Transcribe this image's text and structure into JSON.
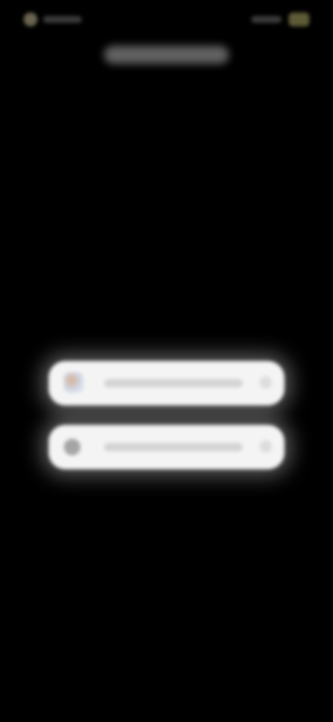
{
  "status_bar": {
    "indicator_icon": "status-dot-icon",
    "battery_icon": "battery-icon"
  },
  "header": {
    "title_present": true
  },
  "actions": [
    {
      "icon": "flower-icon",
      "label": "",
      "chevron": "chevron-right-icon"
    },
    {
      "icon": "circle-icon",
      "label": "",
      "chevron": "chevron-right-icon"
    }
  ]
}
